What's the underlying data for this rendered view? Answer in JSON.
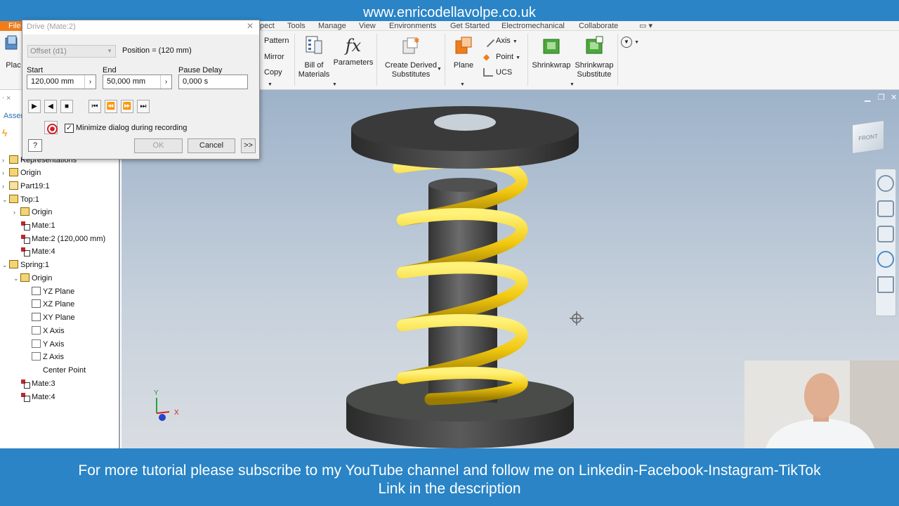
{
  "banner": {
    "website": "www.enricodellavolpe.co.uk"
  },
  "ribbon": {
    "tabs": [
      {
        "label": "File"
      },
      {
        "label": "pect"
      },
      {
        "label": "Tools"
      },
      {
        "label": "Manage"
      },
      {
        "label": "View"
      },
      {
        "label": "Environments"
      },
      {
        "label": "Get Started"
      },
      {
        "label": "Electromechanical"
      },
      {
        "label": "Collaborate"
      }
    ],
    "place_label": "Plac",
    "pattern": "Pattern",
    "mirror": "Mirror",
    "copy": "Copy",
    "bom": "Bill of\nMaterials",
    "bom_l1": "Bill of",
    "bom_l2": "Materials",
    "parameters": "Parameters",
    "derived_l1": "Create Derived",
    "derived_l2": "Substitutes",
    "plane": "Plane",
    "axis": "Axis",
    "point": "Point",
    "ucs": "UCS",
    "shrinkwrap": "Shrinkwrap",
    "shrink_sub_l1": "Shrinkwrap",
    "shrink_sub_l2": "Substitute"
  },
  "dialog": {
    "title": "Drive (Mate:2)",
    "offset_select": "Offset (d1)",
    "position": "Position = (120 mm)",
    "start_label": "Start",
    "start_value": "120,000 mm",
    "end_label": "End",
    "end_value": "50,000 mm",
    "pause_label": "Pause Delay",
    "pause_value": "0,000 s",
    "minimize_label": "Minimize dialog during recording",
    "minimize_checked": true,
    "ok_label": "OK",
    "cancel_label": "Cancel",
    "more_label": ">>",
    "help_label": "?"
  },
  "browser": {
    "assembly_tab": "Assem",
    "rows": [
      {
        "label": "Representations"
      },
      {
        "label": "Origin"
      },
      {
        "label": "Part19:1"
      },
      {
        "label": "Top:1"
      },
      {
        "label": "Origin"
      },
      {
        "label": "Mate:1"
      },
      {
        "label": "Mate:2 (120,000 mm)"
      },
      {
        "label": "Mate:4"
      },
      {
        "label": "Spring:1"
      },
      {
        "label": "Origin"
      },
      {
        "label": "YZ Plane"
      },
      {
        "label": "XZ Plane"
      },
      {
        "label": "XY Plane"
      },
      {
        "label": "X Axis"
      },
      {
        "label": "Y Axis"
      },
      {
        "label": "Z Axis"
      },
      {
        "label": "Center Point"
      },
      {
        "label": "Mate:3"
      },
      {
        "label": "Mate:4"
      }
    ]
  },
  "viewcube": {
    "face": "FRONT"
  },
  "triad": {
    "x": "X",
    "y": "Y"
  },
  "footer": {
    "line1": "For more tutorial please subscribe to my YouTube channel and follow me on Linkedin-Facebook-Instagram-TikTok",
    "line2": "Link in the description"
  },
  "colors": {
    "banner": "#2a84c6",
    "file_tab": "#f07d1a",
    "spring": "#f2c80f",
    "record": "#d1202a"
  }
}
